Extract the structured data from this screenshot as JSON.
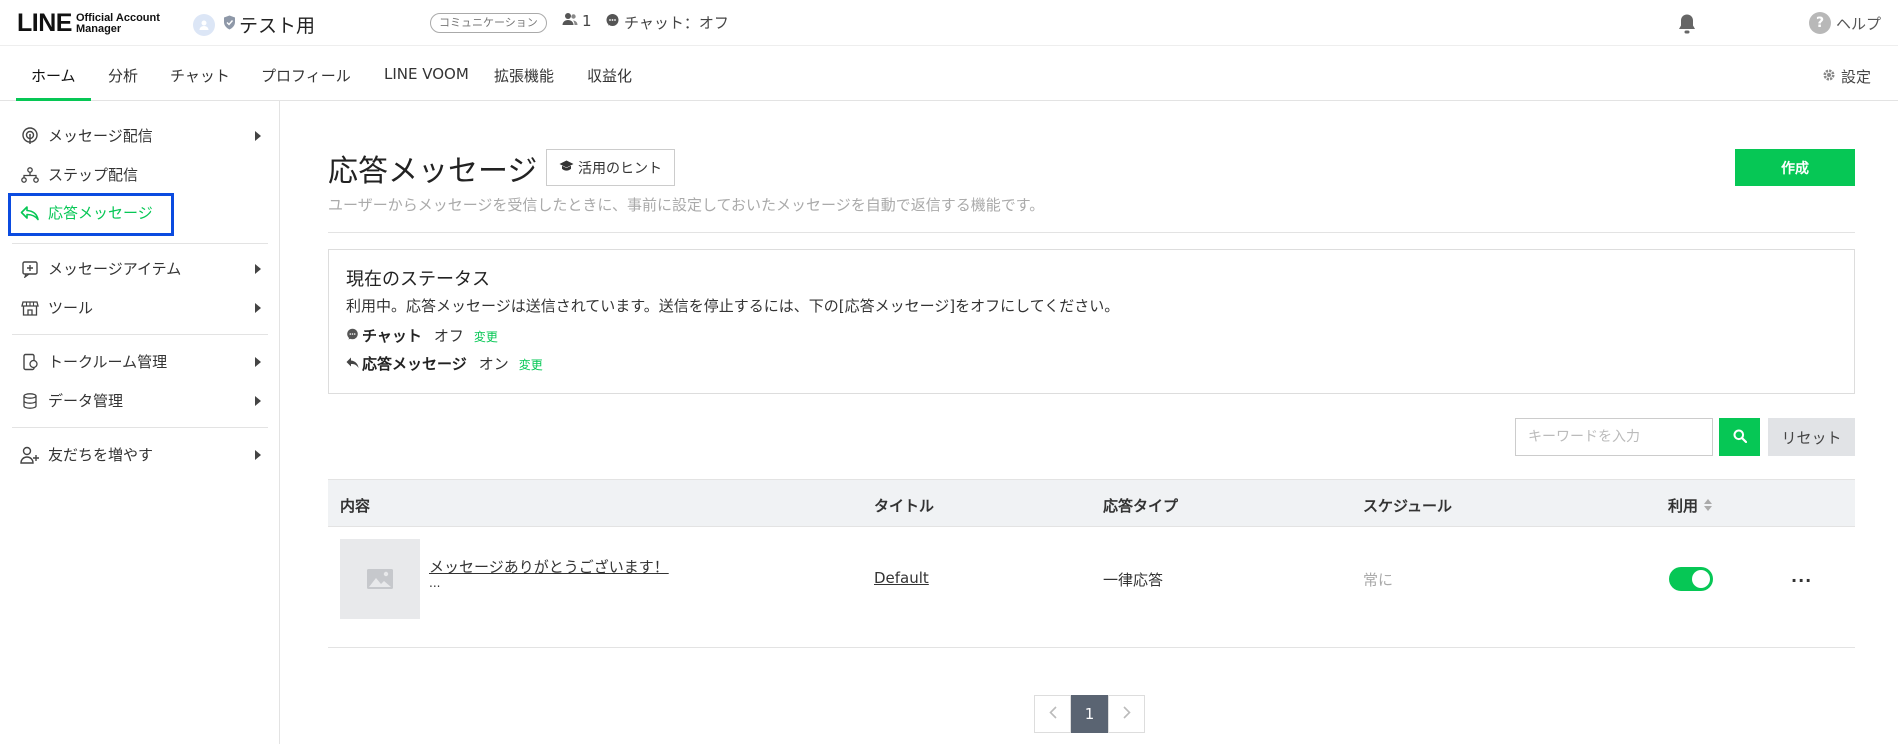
{
  "header": {
    "logo_main": "LINE",
    "logo_sub_line1": "Official Account",
    "logo_sub_line2": "Manager",
    "account_name": "テスト用",
    "account_type": "コミュニケーション",
    "friends_count": "1",
    "chat_status": "チャット：オフ",
    "help_label": "ヘルプ"
  },
  "nav": {
    "tabs": [
      {
        "label": "ホーム",
        "active": true
      },
      {
        "label": "分析"
      },
      {
        "label": "チャット"
      },
      {
        "label": "プロフィール"
      },
      {
        "label": "LINE VOOM"
      },
      {
        "label": "拡張機能"
      },
      {
        "label": "収益化"
      }
    ],
    "settings_label": "設定"
  },
  "sidebar": {
    "items": [
      {
        "label": "メッセージ配信"
      },
      {
        "label": "ステップ配信"
      },
      {
        "label": "応答メッセージ"
      },
      {
        "label": "メッセージアイテム"
      },
      {
        "label": "ツール"
      },
      {
        "label": "トークルーム管理"
      },
      {
        "label": "データ管理"
      },
      {
        "label": "友だちを増やす"
      }
    ]
  },
  "main": {
    "title": "応答メッセージ",
    "hint_label": "活用のヒント",
    "create_label": "作成",
    "description": "ユーザーからメッセージを受信したときに、事前に設定しておいたメッセージを自動で返信する機能です。",
    "status": {
      "title": "現在のステータス",
      "description": "利用中。応答メッセージは送信されています。送信を停止するには、下の[応答メッセージ]をオフにしてください。",
      "chat_label": "チャット",
      "chat_value": "オフ",
      "auto_label": "応答メッセージ",
      "auto_value": "オン",
      "change_label": "変更"
    },
    "search_placeholder": "キーワードを入力",
    "reset_label": "リセット",
    "table": {
      "headers": [
        "内容",
        "タイトル",
        "応答タイプ",
        "スケジュール",
        "利用"
      ],
      "rows": [
        {
          "content": "メッセージありがとうございます！",
          "content_more": "...",
          "title": "Default",
          "type": "一律応答",
          "schedule": "常に",
          "enabled": true,
          "more": "···"
        }
      ]
    },
    "pagination": {
      "current": "1"
    }
  },
  "colors": {
    "accent": "#06c755",
    "highlight_border": "#0b4be0"
  }
}
